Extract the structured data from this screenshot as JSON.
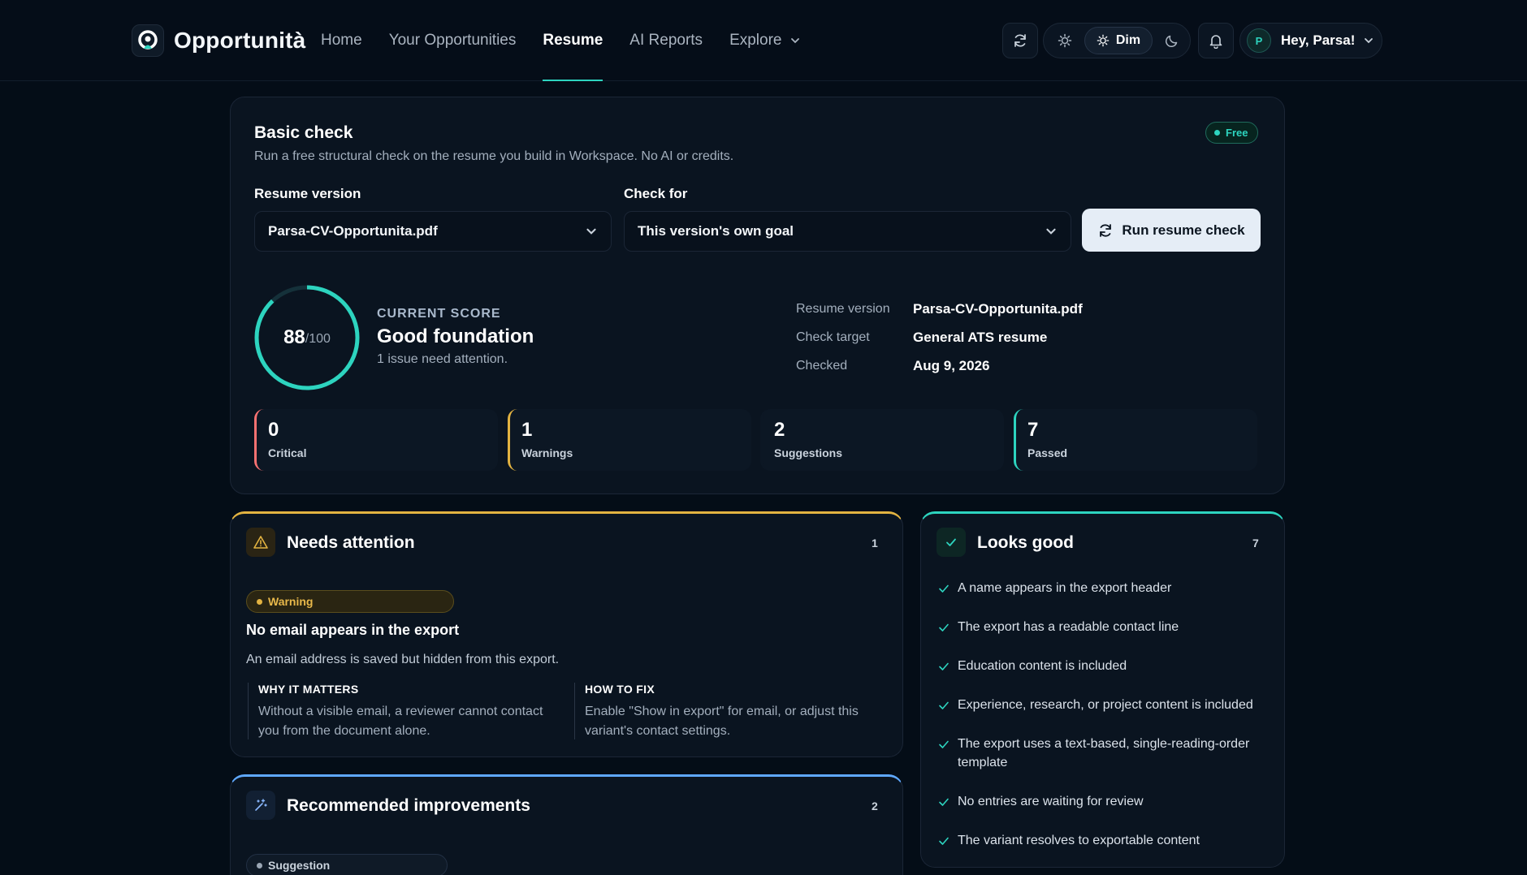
{
  "nav": {
    "brand": "Opportunità",
    "links": [
      {
        "label": "Home"
      },
      {
        "label": "Your Opportunities"
      },
      {
        "label": "Resume"
      },
      {
        "label": "AI Reports"
      },
      {
        "label": "Explore"
      }
    ],
    "active": "Resume",
    "theme": {
      "selected": "Dim"
    },
    "user": {
      "initial": "P",
      "greeting": "Hey, Parsa!"
    }
  },
  "basic_check": {
    "title": "Basic check",
    "subtitle": "Run a free structural check on the resume you build in Workspace. No AI or credits.",
    "badge": "Free",
    "resume_version_label": "Resume version",
    "resume_version_value": "Parsa-CV-Opportunita.pdf",
    "check_for_label": "Check for",
    "check_for_value": "This version's own goal",
    "run_button": "Run resume check",
    "score": {
      "value": 88,
      "value_text": "88",
      "max_text": "/100",
      "kicker": "CURRENT SCORE",
      "headline": "Good foundation",
      "note": "1 issue need attention."
    },
    "meta": [
      {
        "label": "Resume version",
        "value": "Parsa-CV-Opportunita.pdf"
      },
      {
        "label": "Check target",
        "value": "General ATS resume"
      },
      {
        "label": "Checked",
        "value": "Aug 9, 2026"
      }
    ],
    "stats": [
      {
        "count": "0",
        "label": "Critical",
        "color": "#f87171"
      },
      {
        "count": "1",
        "label": "Warnings",
        "color": "#e3b341"
      },
      {
        "count": "2",
        "label": "Suggestions",
        "color": "#0c1724"
      },
      {
        "count": "7",
        "label": "Passed",
        "color": "#2dd4bf"
      }
    ]
  },
  "needs_attention": {
    "title": "Needs attention",
    "count": "1",
    "tag": "Warning",
    "issue_title": "No email appears in the export",
    "issue_desc": "An email address is saved but hidden from this export.",
    "why_head": "WHY IT MATTERS",
    "why_body": "Without a visible email, a reviewer cannot contact you from the document alone.",
    "fix_head": "HOW TO FIX",
    "fix_body": "Enable \"Show in export\" for email, or adjust this variant's contact settings."
  },
  "looks_good": {
    "title": "Looks good",
    "count": "7",
    "items": [
      "A name appears in the export header",
      "The export has a readable contact line",
      "Education content is included",
      "Experience, research, or project content is included",
      "The export uses a text-based, single-reading-order template",
      "No entries are waiting for review",
      "The variant resolves to exportable content"
    ]
  },
  "recommended": {
    "title": "Recommended improvements",
    "count": "2",
    "tag": "Suggestion"
  },
  "colors": {
    "accent": "#2dd4bf",
    "warning": "#e3b341",
    "critical": "#f87171",
    "info": "#5fa8ff"
  }
}
